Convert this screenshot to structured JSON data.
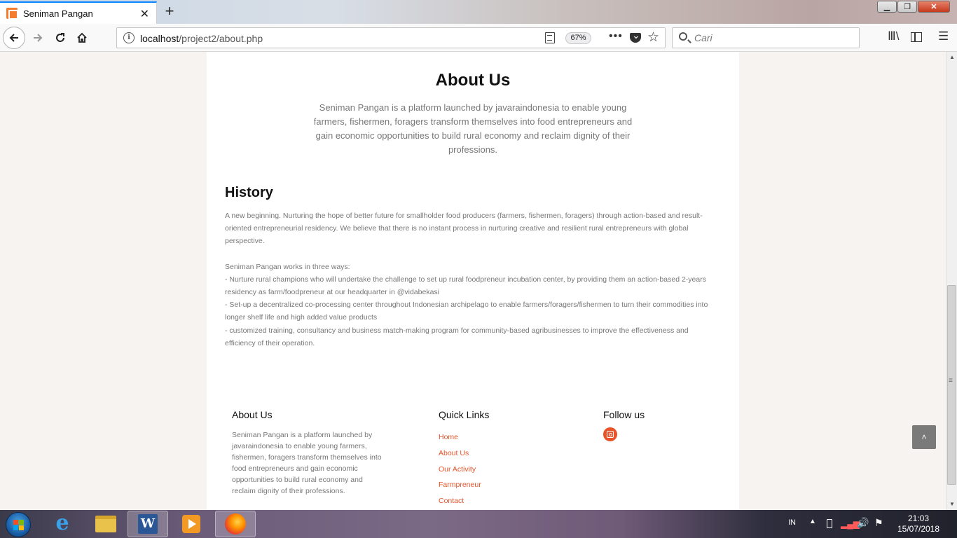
{
  "browser": {
    "tab_title": "Seniman Pangan",
    "tab_close": "✕",
    "new_tab": "+",
    "url_host": "localhost",
    "url_path": "/project2/about.php",
    "zoom": "67%",
    "page_actions": "•••",
    "search_placeholder": "Cari",
    "window_controls": {
      "minimize": "▁",
      "maximize": "❐",
      "close": "✕"
    }
  },
  "page": {
    "about_title": "About Us",
    "about_lead": "Seniman Pangan is a platform launched by javaraindonesia to enable young farmers, fishermen, foragers transform themselves into food entrepreneurs and gain economic opportunities to build rural economy and reclaim dignity of their professions.",
    "history_title": "History",
    "history_p1": "A new beginning. Nurturing the hope of better future for smallholder food producers (farmers, fishermen, foragers) through action-based and result-oriented entrepreneurial residency. We believe that there is no instant process in nurturing creative and resilient rural entrepreneurs with global perspective.",
    "history_p2_intro": "Seniman Pangan works in three ways:",
    "history_p2_items": [
      "- Nurture rural champions who will undertake the challenge to set up rural foodpreneur incubation center, by providing them an action-based 2-years residency as farm/foodpreneur at our headquarter in @vidabekasi",
      "- Set-up a decentralized co-processing center throughout Indonesian archipelago to enable farmers/foragers/fishermen to turn their commodities into longer shelf life and high added value products",
      "- customized training, consultancy and business match-making program for community-based agribusinesses to improve the effectiveness and efficiency of their operation."
    ]
  },
  "footer": {
    "about_heading": "About Us",
    "about_text": "Seniman Pangan is a platform launched by javaraindonesia to enable young farmers, fishermen, foragers transform themselves into food entrepreneurs and gain economic opportunities to build rural economy and reclaim dignity of their professions.",
    "links_heading": "Quick Links",
    "links": [
      "Home",
      "About Us",
      "Our Activity",
      "Farmpreneur",
      "Contact"
    ],
    "follow_heading": "Follow us",
    "accent_color": "#e8532a"
  },
  "back_to_top": "˄",
  "taskbar": {
    "lang": "IN",
    "time": "21:03",
    "date": "15/07/2018"
  }
}
